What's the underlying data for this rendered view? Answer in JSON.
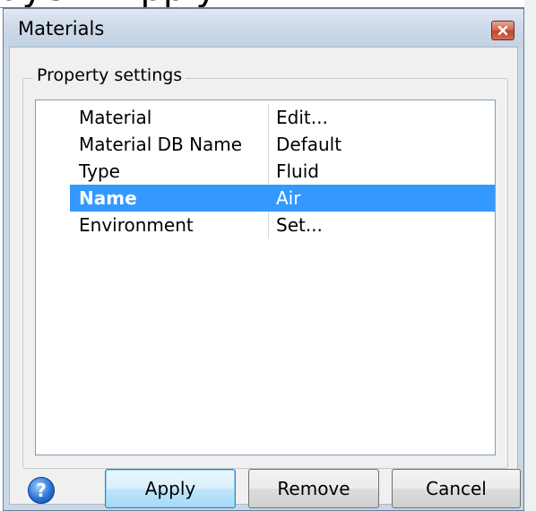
{
  "top_crop_text": "ayer - Apply",
  "window": {
    "title": "Materials",
    "close_icon": "close-icon"
  },
  "group": {
    "label": "Property settings"
  },
  "properties": [
    {
      "name": "Material",
      "value": "Edit...",
      "selected": false
    },
    {
      "name": "Material DB Name",
      "value": "Default",
      "selected": false
    },
    {
      "name": "Type",
      "value": "Fluid",
      "selected": false
    },
    {
      "name": "Name",
      "value": "Air",
      "selected": true
    },
    {
      "name": "Environment",
      "value": "Set...",
      "selected": false
    }
  ],
  "footer": {
    "help_icon": "help-icon",
    "help_glyph": "?",
    "apply_label": "Apply",
    "remove_label": "Remove",
    "cancel_label": "Cancel"
  },
  "colors": {
    "selection": "#3399ff",
    "titlebar": "#cdd9e8",
    "close_button": "#c0462c"
  }
}
